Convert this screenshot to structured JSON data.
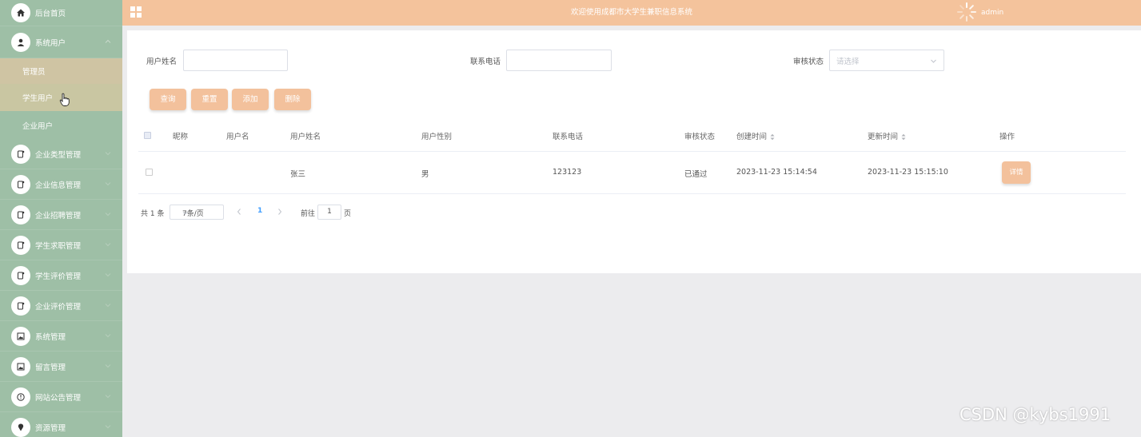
{
  "header": {
    "title": "欢迎使用成都市大学生兼职信息系统",
    "user": "admin"
  },
  "sidebar": {
    "items": [
      {
        "label": "后台首页",
        "icon": "home-icon"
      },
      {
        "label": "系统用户",
        "icon": "user-icon",
        "expanded": true,
        "children": [
          {
            "label": "管理员"
          },
          {
            "label": "学生用户"
          },
          {
            "label": "企业用户"
          }
        ]
      },
      {
        "label": "企业类型管理",
        "icon": "doc-icon"
      },
      {
        "label": "企业信息管理",
        "icon": "doc-icon"
      },
      {
        "label": "企业招聘管理",
        "icon": "doc-icon"
      },
      {
        "label": "学生求职管理",
        "icon": "doc-icon"
      },
      {
        "label": "学生评价管理",
        "icon": "doc-icon"
      },
      {
        "label": "企业评价管理",
        "icon": "doc-icon"
      },
      {
        "label": "系统管理",
        "icon": "image-icon"
      },
      {
        "label": "留言管理",
        "icon": "image-icon"
      },
      {
        "label": "网站公告管理",
        "icon": "info-icon"
      },
      {
        "label": "资源管理",
        "icon": "pin-icon"
      }
    ]
  },
  "search": {
    "name_label": "用户姓名",
    "name_value": "",
    "phone_label": "联系电话",
    "phone_value": "",
    "status_label": "审核状态",
    "status_placeholder": "请选择"
  },
  "buttons": {
    "query": "查询",
    "reset": "重置",
    "add": "添加",
    "delete": "删除"
  },
  "table": {
    "headers": [
      "昵称",
      "用户名",
      "用户姓名",
      "用户性别",
      "联系电话",
      "审核状态",
      "创建时间",
      "更新时间",
      "操作"
    ],
    "rows": [
      {
        "nickname": "",
        "username": "",
        "name": "张三",
        "gender": "男",
        "phone": "123123",
        "status": "已通过",
        "created": "2023-11-23 15:14:54",
        "updated": "2023-11-23 15:15:10",
        "action": "详情"
      }
    ]
  },
  "pagination": {
    "total": "共 1 条",
    "page_size": "7条/页",
    "current_page": "1",
    "goto_label": "前往",
    "goto_value": "1",
    "page_unit": "页"
  },
  "watermark": "CSDN @kybs1991",
  "colors": {
    "sidebar_bg": "#9ebfa6",
    "header_bg": "#f4c39c",
    "button_bg": "#f3c19c",
    "active_submenu": "#cfc4a3",
    "page_bg": "#ececee"
  }
}
